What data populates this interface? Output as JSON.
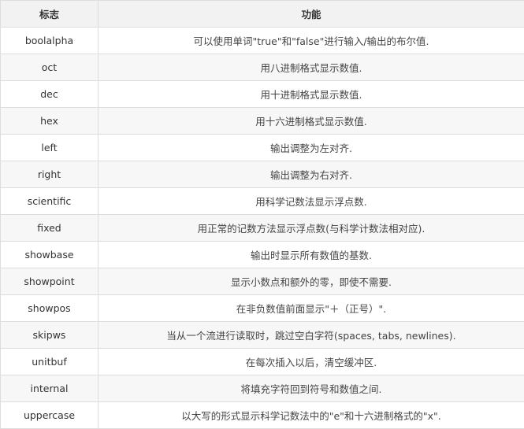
{
  "table": {
    "headers": [
      "标志",
      "功能"
    ],
    "rows": [
      {
        "flag": "boolalpha",
        "desc": "可以使用单词\"true\"和\"false\"进行输入/输出的布尔值."
      },
      {
        "flag": "oct",
        "desc": "用八进制格式显示数值."
      },
      {
        "flag": "dec",
        "desc": "用十进制格式显示数值."
      },
      {
        "flag": "hex",
        "desc": "用十六进制格式显示数值."
      },
      {
        "flag": "left",
        "desc": "输出调整为左对齐."
      },
      {
        "flag": "right",
        "desc": "输出调整为右对齐."
      },
      {
        "flag": "scientific",
        "desc": "用科学记数法显示浮点数."
      },
      {
        "flag": "fixed",
        "desc": "用正常的记数方法显示浮点数(与科学计数法相对应)."
      },
      {
        "flag": "showbase",
        "desc": "输出时显示所有数值的基数."
      },
      {
        "flag": "showpoint",
        "desc": "显示小数点和额外的零，即使不需要."
      },
      {
        "flag": "showpos",
        "desc": "在非负数值前面显示\"＋（正号）\"."
      },
      {
        "flag": "skipws",
        "desc": "当从一个流进行读取时，跳过空白字符(spaces, tabs, newlines)."
      },
      {
        "flag": "unitbuf",
        "desc": "在每次插入以后，清空缓冲区."
      },
      {
        "flag": "internal",
        "desc": "将填充字符回到符号和数值之间."
      },
      {
        "flag": "uppercase",
        "desc": "以大写的形式显示科学记数法中的\"e\"和十六进制格式的\"x\"."
      }
    ]
  }
}
